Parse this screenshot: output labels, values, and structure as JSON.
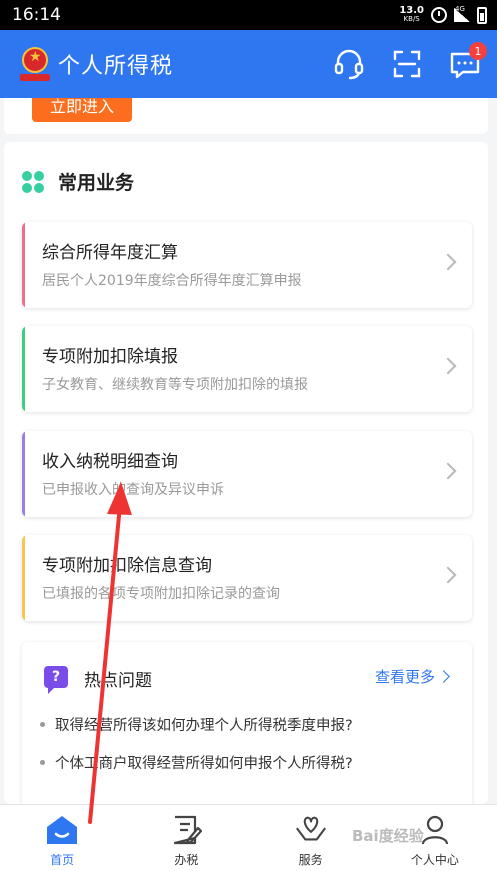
{
  "status_bar": {
    "time": "16:14",
    "net_speed_value": "13.0",
    "net_speed_unit": "KB/S",
    "network": "4G"
  },
  "header": {
    "title": "个人所得税",
    "notification_count": "1",
    "brand_color": "#2f77f1"
  },
  "top_card": {
    "enter_button": "立即进入"
  },
  "services": {
    "title": "常用业务",
    "items": [
      {
        "title": "综合所得年度汇算",
        "desc": "居民个人2019年度综合所得年度汇算申报",
        "accent": "#f06d8d"
      },
      {
        "title": "专项附加扣除填报",
        "desc": "子女教育、继续教育等专项附加扣除的填报",
        "accent": "#3fce7f"
      },
      {
        "title": "收入纳税明细查询",
        "desc": "已申报收入的查询及异议申诉",
        "accent": "#9a7de6"
      },
      {
        "title": "专项附加扣除信息查询",
        "desc": "已填报的各项专项附加扣除记录的查询",
        "accent": "#f8c552"
      }
    ]
  },
  "hot_questions": {
    "title": "热点问题",
    "see_more": "查看更多",
    "items": [
      "取得经营所得该如何办理个人所得税季度申报?",
      "个体工商户取得经营所得如何申报个人所得税?"
    ]
  },
  "tab_bar": {
    "tabs": [
      {
        "label": "首页",
        "icon": "home-icon"
      },
      {
        "label": "办税",
        "icon": "tax-form-icon"
      },
      {
        "label": "服务",
        "icon": "heart-hands-icon"
      },
      {
        "label": "个人中心",
        "icon": "person-icon"
      }
    ]
  },
  "annotation_color": "#ee3333"
}
